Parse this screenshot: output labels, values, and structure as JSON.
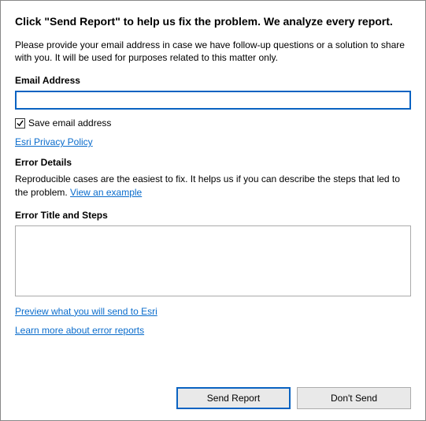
{
  "heading": "Click \"Send Report\" to help us fix the problem. We analyze every report.",
  "intro": "Please provide your email address in case we have follow-up questions or a solution to share with you. It will be used for purposes related to this matter only.",
  "email": {
    "label": "Email Address",
    "value": "",
    "save_checked": true,
    "save_label": "Save email address"
  },
  "privacy_link": "Esri Privacy Policy",
  "error_details": {
    "label": "Error Details",
    "text_prefix": "Reproducible cases are the easiest to fix. It helps us if you can describe the steps that led to the problem. ",
    "example_link": "View an example"
  },
  "title_steps": {
    "label": "Error Title and Steps",
    "value": ""
  },
  "links": {
    "preview": "Preview what you will send to Esri",
    "learn": "Learn more about error reports"
  },
  "buttons": {
    "send": "Send Report",
    "dont": "Don't Send"
  }
}
